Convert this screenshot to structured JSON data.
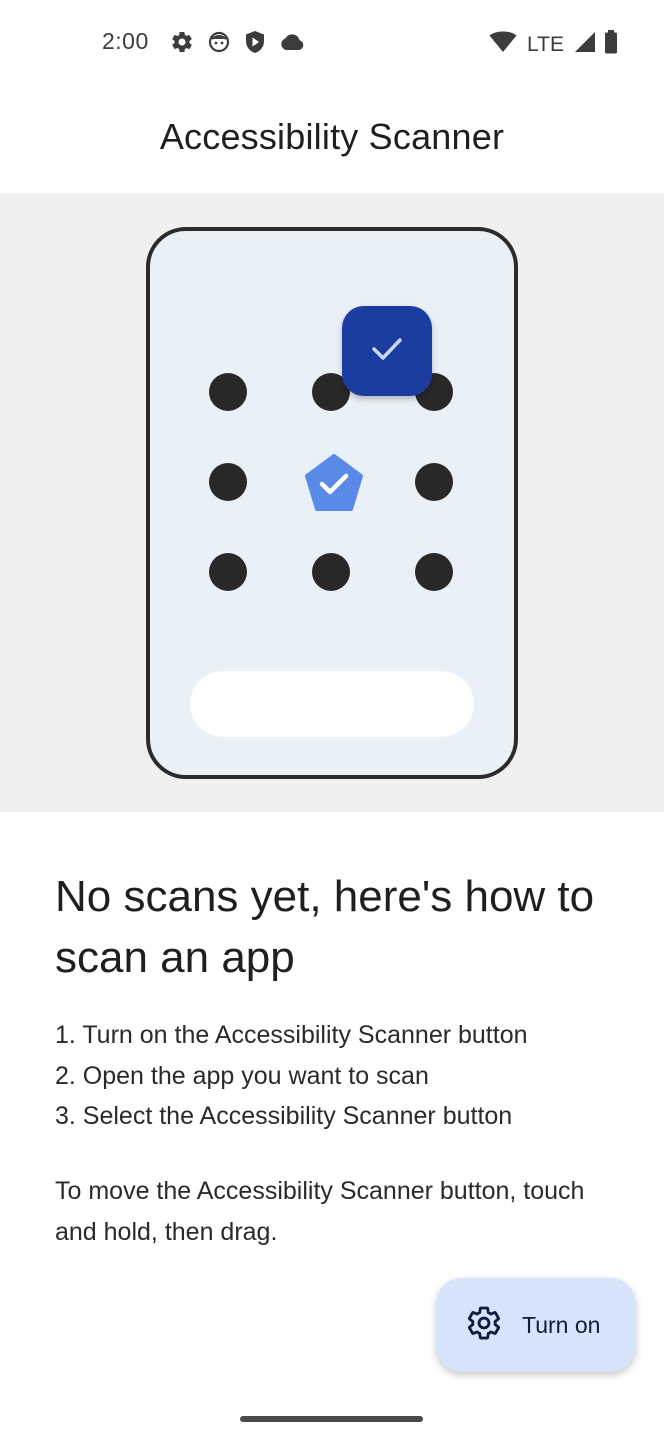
{
  "status_bar": {
    "time": "2:00",
    "left_icons": [
      "settings-icon",
      "face-icon",
      "shield-play-icon",
      "cloud-icon"
    ],
    "network": "LTE",
    "right_icons": [
      "wifi-icon",
      "signal-icon",
      "battery-icon"
    ]
  },
  "app_bar": {
    "title": "Accessibility Scanner"
  },
  "illustration": {
    "dot_grid": "3x3",
    "badge_icon": "check-icon",
    "pentagon_icon": "check-icon",
    "colors": {
      "frame": "#2b2b2b",
      "screen": "#eaf0f8",
      "dots": "#282828",
      "badge": "#1b3da0",
      "pentagon": "#5a8ae8",
      "background": "#f0f0f0"
    }
  },
  "content": {
    "heading": "No scans yet, here's how to scan an app",
    "steps": [
      "1. Turn on the Accessibility Scanner button",
      "2. Open the app you want to scan",
      "3. Select the Accessibility Scanner button"
    ],
    "hint": "To move the Accessibility Scanner button, touch and hold, then drag."
  },
  "fab": {
    "icon": "gear-icon",
    "label": "Turn on",
    "color": "#d7e3fb"
  }
}
